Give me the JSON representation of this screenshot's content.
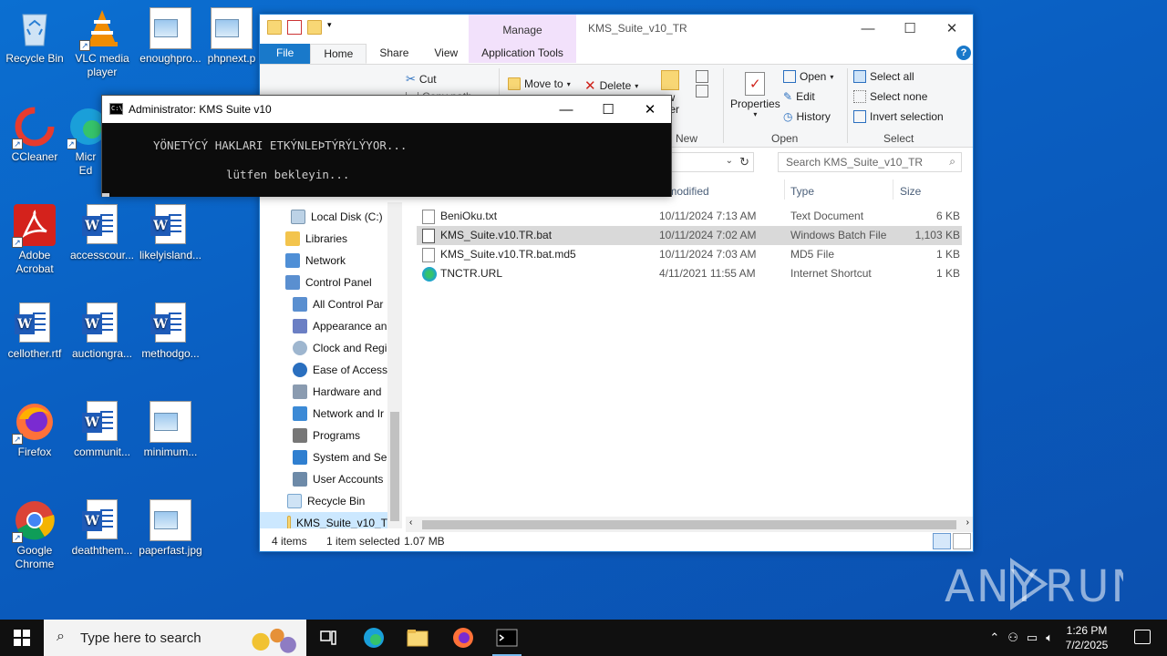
{
  "desktop": {
    "icons": [
      {
        "label": "Recycle Bin"
      },
      {
        "label": "VLC media player"
      },
      {
        "label": "enoughpro..."
      },
      {
        "label": "phpnext.p"
      },
      {
        "label": "CCleaner"
      },
      {
        "label": "Micr Ed"
      },
      {
        "label": "Adobe Acrobat"
      },
      {
        "label": "accesscour..."
      },
      {
        "label": "likelyisland..."
      },
      {
        "label": "cellother.rtf"
      },
      {
        "label": "auctiongra..."
      },
      {
        "label": "methodgo..."
      },
      {
        "label": "Firefox"
      },
      {
        "label": "communit..."
      },
      {
        "label": "minimum..."
      },
      {
        "label": "Google Chrome"
      },
      {
        "label": "deaththem..."
      },
      {
        "label": "paperfast.jpg"
      }
    ]
  },
  "explorer": {
    "title": "KMS_Suite_v10_TR",
    "manage_label": "Manage",
    "tabs": {
      "file": "File",
      "home": "Home",
      "share": "Share",
      "view": "View",
      "app_tools": "Application Tools"
    },
    "ribbon": {
      "cut": "Cut",
      "copy_path": "Copy path",
      "move_to": "Move to",
      "delete": "Delete",
      "new_folder": "ew lder",
      "new_group": "New",
      "properties": "Properties",
      "open": "Open",
      "edit": "Edit",
      "history": "History",
      "open_group": "Open",
      "select_all": "Select all",
      "select_none": "Select none",
      "invert_selection": "Invert selection",
      "select_group": "Select"
    },
    "search_placeholder": "Search KMS_Suite_v10_TR",
    "nav": [
      {
        "label": "Local Disk (C:)"
      },
      {
        "label": "Libraries"
      },
      {
        "label": "Network"
      },
      {
        "label": "Control Panel"
      },
      {
        "label": "All Control Par"
      },
      {
        "label": "Appearance an"
      },
      {
        "label": "Clock and Regi"
      },
      {
        "label": "Ease of Access"
      },
      {
        "label": "Hardware and"
      },
      {
        "label": "Network and Ir"
      },
      {
        "label": "Programs"
      },
      {
        "label": "System and Se"
      },
      {
        "label": "User Accounts"
      },
      {
        "label": "Recycle Bin"
      },
      {
        "label": "KMS_Suite_v10_T"
      }
    ],
    "columns": {
      "date": "te modified",
      "type": "Type",
      "size": "Size"
    },
    "files": [
      {
        "name": "BeniOku.txt",
        "date": "10/11/2024 7:13 AM",
        "type": "Text Document",
        "size": "6 KB"
      },
      {
        "name": "KMS_Suite.v10.TR.bat",
        "date": "10/11/2024 7:02 AM",
        "type": "Windows Batch File",
        "size": "1,103 KB"
      },
      {
        "name": "KMS_Suite.v10.TR.bat.md5",
        "date": "10/11/2024 7:03 AM",
        "type": "MD5 File",
        "size": "1 KB"
      },
      {
        "name": "TNCTR.URL",
        "date": "4/11/2021 11:55 AM",
        "type": "Internet Shortcut",
        "size": "1 KB"
      }
    ],
    "status": {
      "count": "4 items",
      "selected": "1 item selected",
      "size": "1.07 MB"
    }
  },
  "cmd": {
    "title": "Administrator:  KMS Suite v10",
    "line1": "YÖNETÝCÝ HAKLARI ETKÝNLEÞTÝRÝLÝYOR...",
    "line2": "lütfen bekleyin..."
  },
  "taskbar": {
    "search_placeholder": "Type here to search",
    "time": "1:26 PM",
    "date": "7/2/2025"
  },
  "watermark": "ANY RUN"
}
